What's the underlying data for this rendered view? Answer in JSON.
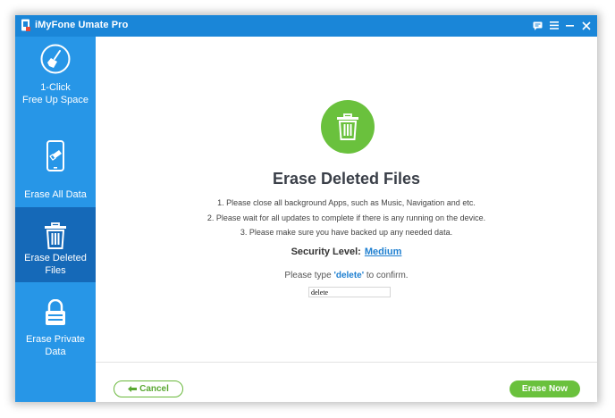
{
  "app": {
    "title": "iMyFone Umate Pro"
  },
  "colors": {
    "titlebar": "#1a86d8",
    "sidebar": "#2796e7",
    "sidebar_active": "#1569b8",
    "accent_green": "#6ac13d",
    "link_blue": "#1e7fd0"
  },
  "window_controls": [
    {
      "name": "feedback-icon",
      "glyph": "speech-bubble"
    },
    {
      "name": "menu-icon",
      "glyph": "hamburger"
    },
    {
      "name": "minimize-icon",
      "glyph": "minus"
    },
    {
      "name": "close-icon",
      "glyph": "x"
    }
  ],
  "sidebar": {
    "items": [
      {
        "label": "1-Click\nFree Up Space",
        "icon": "broom-icon",
        "active": false
      },
      {
        "label": "Erase All Data",
        "icon": "phone-eraser-icon",
        "active": false
      },
      {
        "label": "Erase Deleted\nFiles",
        "icon": "trash-icon",
        "active": true
      },
      {
        "label": "Erase Private\nData",
        "icon": "lock-icon",
        "active": false
      }
    ]
  },
  "main": {
    "heading": "Erase Deleted Files",
    "notes": [
      "1. Please close all background Apps, such as Music, Navigation and etc.",
      "2. Please wait for all updates to complete if there is any running on the device.",
      "3. Please make sure you have backed up any needed data."
    ],
    "security_label": "Security Level:",
    "security_value": "Medium",
    "confirm_prefix": "Please type ",
    "confirm_keyword": "'delete'",
    "confirm_suffix": " to confirm.",
    "confirm_input_value": "delete"
  },
  "footer": {
    "cancel_label": "Cancel",
    "erase_label": "Erase Now"
  }
}
